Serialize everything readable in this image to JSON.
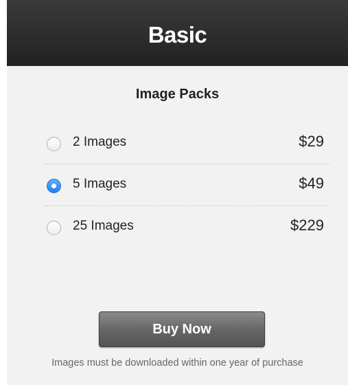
{
  "plan": {
    "title": "Basic",
    "subtitle": "Image Packs",
    "options": [
      {
        "label": "2 Images",
        "price": "$29",
        "selected": false
      },
      {
        "label": "5 Images",
        "price": "$49",
        "selected": true
      },
      {
        "label": "25 Images",
        "price": "$229",
        "selected": false
      }
    ],
    "buy_label": "Buy Now",
    "note": "Images must be downloaded within one year of purchase"
  },
  "colors": {
    "header_bg": "#2b2b2b",
    "card_bg": "#f2f2f2",
    "radio_selected": "#2b86f0",
    "button_bg": "#6b6b6b"
  }
}
